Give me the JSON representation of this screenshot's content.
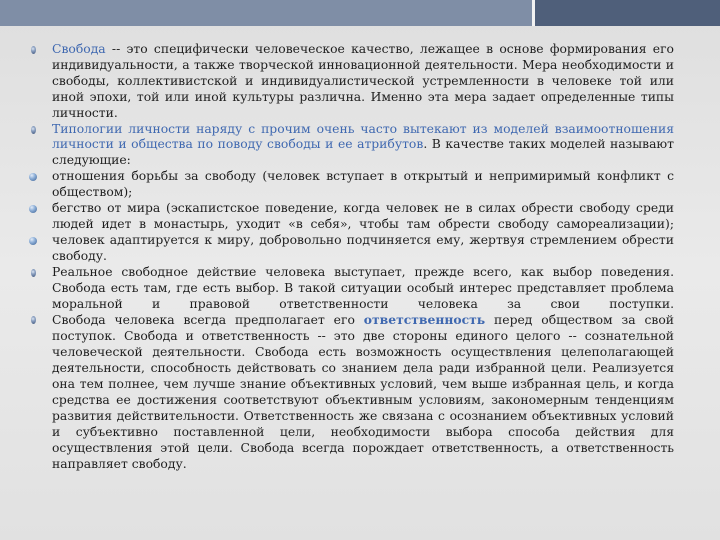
{
  "paragraphs": [
    {
      "bullet": "oval",
      "parts": [
        {
          "style": "blue",
          "text": "Свобода"
        },
        {
          "style": "plain",
          "text": " -- это специфически человеческое качество, лежащее в основе формирования его индивидуальности, а также творческой инновационной деятельности. Мера необходимости и свободы, коллективистской и индивидуалистической устремленности в человеке той или иной эпохи, той или иной культуры различна. Именно эта мера задает определенные типы личности."
        }
      ]
    },
    {
      "bullet": "oval",
      "parts": [
        {
          "style": "blue",
          "text": "Типологии личности наряду с прочим очень часто вытекают из моделей взаимоотношения личности и общества по поводу свободы и ее атрибутов"
        },
        {
          "style": "plain",
          "text": ". В качестве таких моделей называют следующие:"
        }
      ]
    },
    {
      "bullet": "round",
      "parts": [
        {
          "style": "plain",
          "text": "отношения борьбы за свободу (человек вступает в открытый и непримиримый конфликт с обществом);"
        }
      ]
    },
    {
      "bullet": "round",
      "parts": [
        {
          "style": "plain",
          "text": "бегство от мира (эскапистское поведение, когда человек не в силах обрести свободу среди людей идет в монастырь, уходит «в себя», чтобы там обрести свободу самореализации);"
        }
      ]
    },
    {
      "bullet": "round",
      "parts": [
        {
          "style": "plain",
          "text": "человек адаптируется к миру, добровольно подчиняется ему, жертвуя стремлением обрести свободу."
        }
      ]
    },
    {
      "bullet": "oval",
      "parts": [
        {
          "style": "plain",
          "text": "Реальное свободное действие человека выступает, прежде всего, как выбор поведения. Свобода есть там, где есть выбор. В такой ситуации особый интерес представляет проблема моральной и правовой ответственности человека за свои поступки."
        }
      ]
    },
    {
      "bullet": "oval",
      "parts": [
        {
          "style": "plain",
          "text": "Свобода человека всегда предполагает его "
        },
        {
          "style": "bold-blue",
          "text": "ответственность"
        },
        {
          "style": "plain",
          "text": " перед обществом за свой поступок. Свобода и ответственность -- это две стороны единого целого -- сознательной человеческой деятельности. Свобода есть возможность осуществления целеполагающей деятельности, способность действовать со знанием дела ради избранной цели. Реализуется она тем полнее, чем лучше знание объективных условий, чем выше избранная цель, и когда средства ее достижения соответствуют объективным условиям, закономерным тенденциям развития действительности. Ответственность же связана с осознанием объективных условий и субъективно поставленной цели, необходимости выбора способа действия для осуществления этой цели. Свобода всегда порождает ответственность, а ответственность направляет свободу."
        }
      ]
    }
  ]
}
